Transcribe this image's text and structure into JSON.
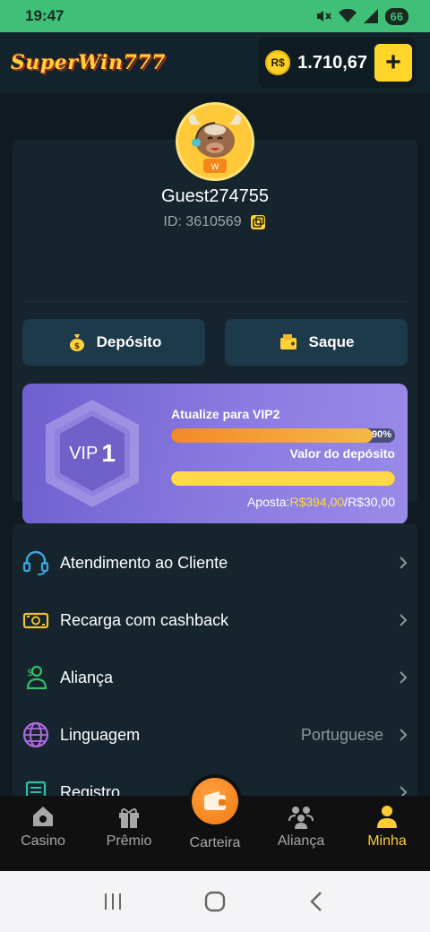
{
  "status_bar": {
    "time": "19:47",
    "battery": "66"
  },
  "header": {
    "logo": "SuperWin777",
    "currency_symbol": "R$",
    "balance": "1.710,67",
    "add_label": "+"
  },
  "profile": {
    "username": "Guest274755",
    "id_text": "ID: 3610569"
  },
  "actions": {
    "deposit_label": "Depósito",
    "withdraw_label": "Saque"
  },
  "vip": {
    "label": "VIP",
    "level": "1",
    "upgrade_text": "Atualize para VIP2",
    "progress_percent_text": "90%",
    "progress_fraction": 0.9,
    "deposit_value_label": "Valor do depósito",
    "bet_label": "Aposta:",
    "bet_current": "R$394,00",
    "bet_separator": "/",
    "bet_target": "R$30,00",
    "bet_fraction": 1.0
  },
  "menu": {
    "items": [
      {
        "label": "Atendimento ao Cliente",
        "icon": "headset-icon"
      },
      {
        "label": "Recarga com cashback",
        "icon": "cashback-icon"
      },
      {
        "label": "Aliança",
        "icon": "alliance-icon"
      },
      {
        "label": "Linguagem",
        "icon": "globe-icon",
        "value": "Portuguese"
      },
      {
        "label": "Registro",
        "icon": "record-icon"
      }
    ]
  },
  "bottom_nav": {
    "items": [
      {
        "label": "Casino",
        "icon": "home-icon"
      },
      {
        "label": "Prêmio",
        "icon": "gift-icon"
      },
      {
        "label": "Carteira",
        "icon": "wallet-icon"
      },
      {
        "label": "Aliança",
        "icon": "group-icon"
      },
      {
        "label": "Minha",
        "icon": "user-icon"
      }
    ],
    "active": "Minha"
  },
  "colors": {
    "accent_yellow": "#ffd529",
    "vip_purple": "#7f6fd9",
    "status_green": "#3fbf78",
    "wallet_orange": "#f4861a"
  }
}
